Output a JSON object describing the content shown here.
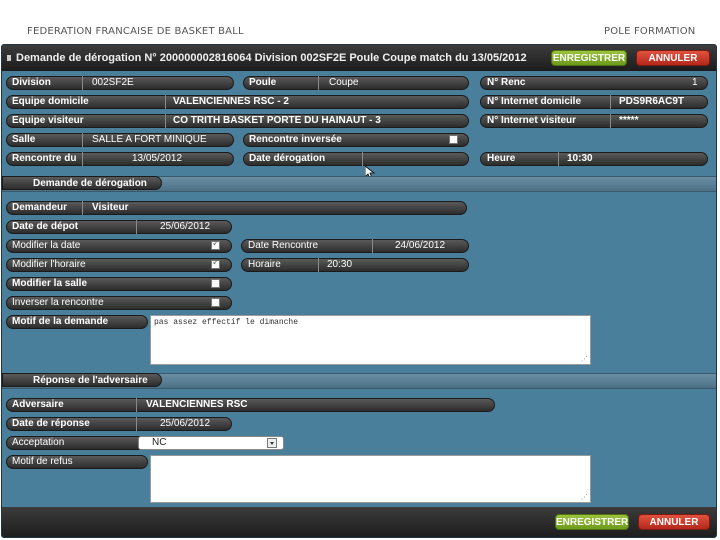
{
  "slide": {
    "left_header": "FEDERATION FRANCAISE DE BASKET BALL",
    "right_header": "POLE FORMATION"
  },
  "window": {
    "title": "Demande de dérogation N° 200000002816064 Division 002SF2E Poule Coupe match du 13/05/2012"
  },
  "buttons": {
    "save": "ENREGISTRER",
    "cancel": "ANNULER"
  },
  "match": {
    "division": {
      "label": "Division",
      "value": "002SF2E"
    },
    "poule": {
      "label": "Poule",
      "value": "Coupe"
    },
    "rencontre_no": {
      "label": "N° Renc",
      "value": "1"
    },
    "equipe_domicile": {
      "label": "Equipe domicile",
      "value": "VALENCIENNES RSC - 2"
    },
    "internet_domicile": {
      "label": "N° Internet domicile",
      "value": "PDS9R6AC9T"
    },
    "equipe_visiteur": {
      "label": "Equipe visiteur",
      "value": "CO TRITH BASKET PORTE DU HAINAUT - 3"
    },
    "internet_visiteur": {
      "label": "N° Internet visiteur",
      "value": "*****"
    },
    "salle": {
      "label": "Salle",
      "value": "SALLE A FORT MINIQUE"
    },
    "rencontre_inversee": {
      "label": "Rencontre inversée",
      "checked": false
    },
    "rencontre_du": {
      "label": "Rencontre du",
      "value": "13/05/2012"
    },
    "date_derogation": {
      "label": "Date dérogation",
      "value": ""
    },
    "heure": {
      "label": "Heure",
      "value": "10:30"
    }
  },
  "demande": {
    "section_title": "Demande de dérogation",
    "demandeur": {
      "label": "Demandeur",
      "value": "Visiteur"
    },
    "date_depot": {
      "label": "Date de dépot",
      "value": "25/06/2012"
    },
    "modifier_date": {
      "label": "Modifier la date",
      "checked": true
    },
    "modifier_horaire": {
      "label": "Modifier l'horaire",
      "checked": true
    },
    "modifier_salle": {
      "label": "Modifier la salle",
      "checked": false
    },
    "inverser": {
      "label": "Inverser la rencontre",
      "checked": false
    },
    "date_rencontre": {
      "label": "Date Rencontre",
      "value": "24/06/2012"
    },
    "horaire": {
      "label": "Horaire",
      "value": "20:30"
    },
    "motif": {
      "label": "Motif de la demande",
      "value": "pas assez effectif le dimanche"
    }
  },
  "reponse": {
    "section_title": "Réponse de l'adversaire",
    "adversaire": {
      "label": "Adversaire",
      "value": "VALENCIENNES RSC"
    },
    "date_reponse": {
      "label": "Date de réponse",
      "value": "25/06/2012"
    },
    "acceptation": {
      "label": "Acceptation",
      "value": "NC"
    },
    "motif_refus": {
      "label": "Motif de refus",
      "value": ""
    }
  },
  "footer_buttons": {
    "save": "ENREGISTRER",
    "cancel": "ANNULER"
  },
  "colors": {
    "panel": "#4a7f9c",
    "pill": "#3a3a3a",
    "save": "#8ab430",
    "cancel": "#c8382a"
  }
}
